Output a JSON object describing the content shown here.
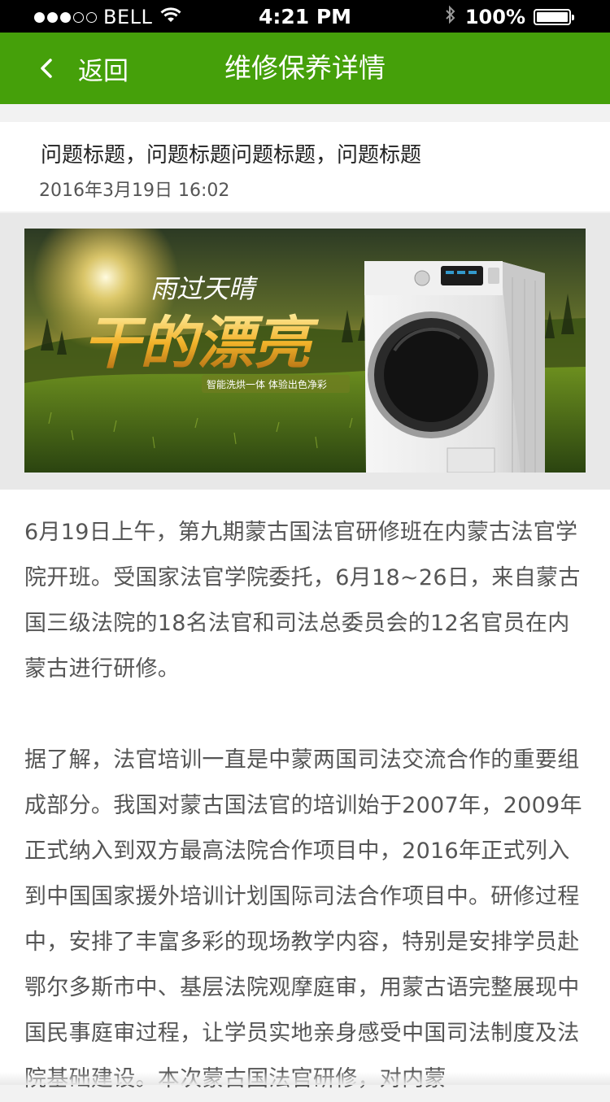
{
  "status_bar": {
    "carrier": "BELL",
    "time": "4:21 PM",
    "battery": "100%",
    "battery_level": 1.0,
    "signal_strength": 3,
    "signal_max": 5
  },
  "nav": {
    "back_label": "返回",
    "title": "维修保养详情",
    "accent_color": "#45a00a"
  },
  "article": {
    "title": "问题标题，问题标题问题标题，问题标题",
    "date": "2016年3月19日 16:02",
    "banner": {
      "headline_small": "雨过天晴",
      "headline_large": "干的漂亮",
      "tagline": "智能洗烘一体  体验出色净彩"
    },
    "paragraphs": [
      "6月19日上午，第九期蒙古国法官研修班在内蒙古法官学院开班。受国家法官学院委托，6月18~26日，来自蒙古国三级法院的18名法官和司法总委员会的12名官员在内蒙古进行研修。",
      "据了解，法官培训一直是中蒙两国司法交流合作的重要组成部分。我国对蒙古国法官的培训始于2007年，2009年正式纳入到双方最高法院合作项目中，2016年正式列入到中国国家援外培训计划国际司法合作项目中。研修过程中，安排了丰富多彩的现场教学内容，特别是安排学员赴鄂尔多斯市中、基层法院观摩庭审，用蒙古语完整展现中国民事庭审过程，让学员实地亲身感受中国司法制度及法院基础建设。本次蒙古国法官研修，对内蒙"
    ]
  },
  "icons": {
    "back": "chevron-left-icon",
    "wifi": "wifi-icon",
    "bluetooth": "bluetooth-icon",
    "battery": "battery-icon"
  }
}
